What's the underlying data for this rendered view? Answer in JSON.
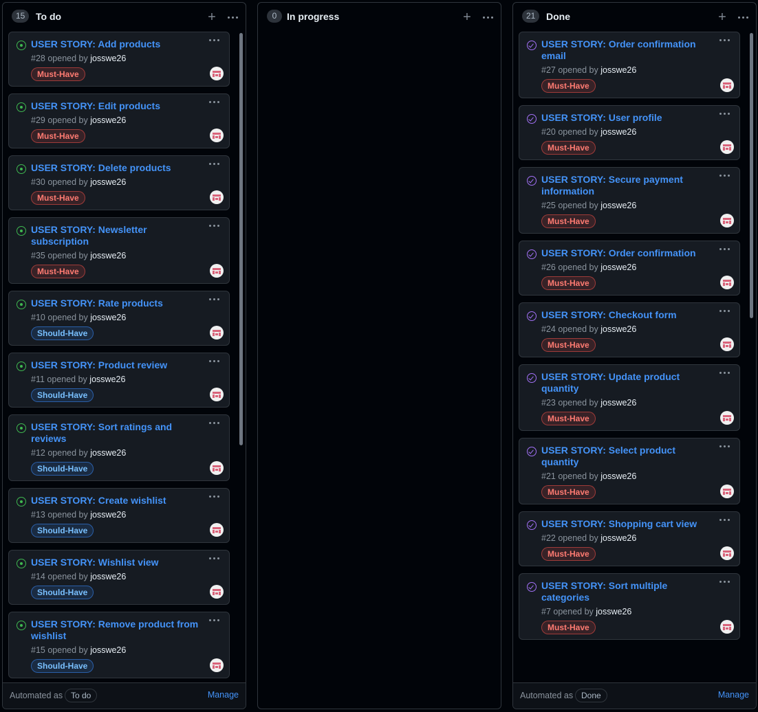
{
  "columns": [
    {
      "id": "todo",
      "count": "15",
      "title": "To do",
      "automated_text": "Automated as",
      "automated_value": "To do",
      "manage_label": "Manage",
      "cards": [
        {
          "title": "USER STORY: Add products",
          "number": "#28",
          "opened_by": "opened by",
          "user": "josswe26",
          "label": "Must-Have",
          "label_type": "must",
          "status": "open"
        },
        {
          "title": "USER STORY: Edit products",
          "number": "#29",
          "opened_by": "opened by",
          "user": "josswe26",
          "label": "Must-Have",
          "label_type": "must",
          "status": "open"
        },
        {
          "title": "USER STORY: Delete products",
          "number": "#30",
          "opened_by": "opened by",
          "user": "josswe26",
          "label": "Must-Have",
          "label_type": "must",
          "status": "open"
        },
        {
          "title": "USER STORY: Newsletter subscription",
          "number": "#35",
          "opened_by": "opened by",
          "user": "josswe26",
          "label": "Must-Have",
          "label_type": "must",
          "status": "open"
        },
        {
          "title": "USER STORY: Rate products",
          "number": "#10",
          "opened_by": "opened by",
          "user": "josswe26",
          "label": "Should-Have",
          "label_type": "should",
          "status": "open"
        },
        {
          "title": "USER STORY: Product review",
          "number": "#11",
          "opened_by": "opened by",
          "user": "josswe26",
          "label": "Should-Have",
          "label_type": "should",
          "status": "open"
        },
        {
          "title": "USER STORY: Sort ratings and reviews",
          "number": "#12",
          "opened_by": "opened by",
          "user": "josswe26",
          "label": "Should-Have",
          "label_type": "should",
          "status": "open"
        },
        {
          "title": "USER STORY: Create wishlist",
          "number": "#13",
          "opened_by": "opened by",
          "user": "josswe26",
          "label": "Should-Have",
          "label_type": "should",
          "status": "open"
        },
        {
          "title": "USER STORY: Wishlist view",
          "number": "#14",
          "opened_by": "opened by",
          "user": "josswe26",
          "label": "Should-Have",
          "label_type": "should",
          "status": "open"
        },
        {
          "title": "USER STORY: Remove product from wishlist",
          "number": "#15",
          "opened_by": "opened by",
          "user": "josswe26",
          "label": "Should-Have",
          "label_type": "should",
          "status": "open"
        }
      ]
    },
    {
      "id": "progress",
      "count": "0",
      "title": "In progress",
      "cards": []
    },
    {
      "id": "done",
      "count": "21",
      "title": "Done",
      "automated_text": "Automated as",
      "automated_value": "Done",
      "manage_label": "Manage",
      "cards": [
        {
          "title": "USER STORY: Order confirmation email",
          "number": "#27",
          "opened_by": "opened by",
          "user": "josswe26",
          "label": "Must-Have",
          "label_type": "must",
          "status": "done"
        },
        {
          "title": "USER STORY: User profile",
          "number": "#20",
          "opened_by": "opened by",
          "user": "josswe26",
          "label": "Must-Have",
          "label_type": "must",
          "status": "done"
        },
        {
          "title": "USER STORY: Secure payment information",
          "number": "#25",
          "opened_by": "opened by",
          "user": "josswe26",
          "label": "Must-Have",
          "label_type": "must",
          "status": "done"
        },
        {
          "title": "USER STORY: Order confirmation",
          "number": "#26",
          "opened_by": "opened by",
          "user": "josswe26",
          "label": "Must-Have",
          "label_type": "must",
          "status": "done"
        },
        {
          "title": "USER STORY: Checkout form",
          "number": "#24",
          "opened_by": "opened by",
          "user": "josswe26",
          "label": "Must-Have",
          "label_type": "must",
          "status": "done"
        },
        {
          "title": "USER STORY: Update product quantity",
          "number": "#23",
          "opened_by": "opened by",
          "user": "josswe26",
          "label": "Must-Have",
          "label_type": "must",
          "status": "done"
        },
        {
          "title": "USER STORY: Select product quantity",
          "number": "#21",
          "opened_by": "opened by",
          "user": "josswe26",
          "label": "Must-Have",
          "label_type": "must",
          "status": "done"
        },
        {
          "title": "USER STORY: Shopping cart view",
          "number": "#22",
          "opened_by": "opened by",
          "user": "josswe26",
          "label": "Must-Have",
          "label_type": "must",
          "status": "done"
        },
        {
          "title": "USER STORY: Sort multiple categories",
          "number": "#7",
          "opened_by": "opened by",
          "user": "josswe26",
          "label": "Must-Have",
          "label_type": "must",
          "status": "done"
        }
      ]
    }
  ],
  "icons": {
    "open_status": "issue-open-icon",
    "done_status": "issue-closed-icon",
    "add": "plus-icon",
    "menu": "kebab-menu-icon",
    "avatar": "avatar"
  },
  "colors": {
    "background": "#010409",
    "card": "#161b22",
    "link": "#4493f8",
    "must_have": "#ff7b72",
    "should_have": "#79c0ff",
    "open_icon": "#3fb950",
    "done_icon": "#a371f7"
  }
}
